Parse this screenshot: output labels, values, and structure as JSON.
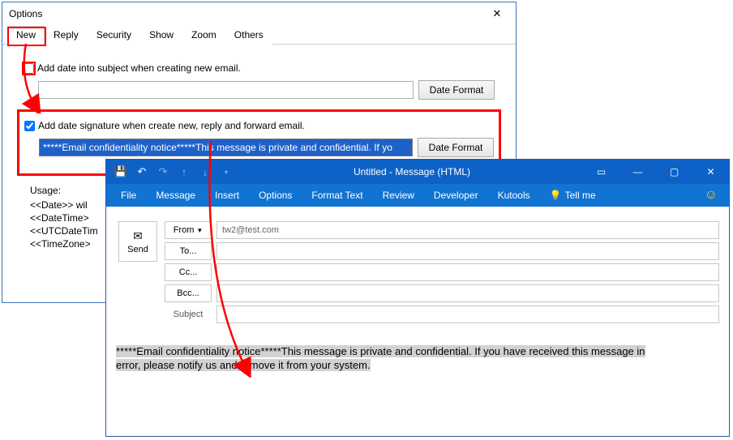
{
  "options": {
    "title": "Options",
    "tabs": [
      "New",
      "Reply",
      "Security",
      "Show",
      "Zoom",
      "Others"
    ],
    "active_tab": "New",
    "add_date_subject_label": "Add date into subject when creating new email.",
    "add_date_subject_checked": false,
    "add_date_subject_value": "",
    "date_format_btn": "Date Format",
    "add_sig_label": "Add date signature when create new, reply and forward email.",
    "add_sig_checked": true,
    "add_sig_value": "*****Email confidentiality notice*****This message is private and confidential. If yo",
    "usage_label": "Usage:",
    "usage_lines": [
      "<<Date>> wil",
      "<<DateTime>",
      "<<UTCDateTim",
      "<<TimeZone>"
    ]
  },
  "compose": {
    "window_title": "Untitled  -  Message (HTML)",
    "menu": [
      "File",
      "Message",
      "Insert",
      "Options",
      "Format Text",
      "Review",
      "Developer",
      "Kutools"
    ],
    "tell_me": "Tell me",
    "from_label": "From",
    "from_value": "tw2@test.com",
    "to_label": "To...",
    "cc_label": "Cc...",
    "bcc_label": "Bcc...",
    "subject_label": "Subject",
    "subject_value": "",
    "send_label": "Send",
    "body_line1": "*****Email confidentiality notice*****This message is private and confidential. If you have received this message in",
    "body_line2": "error, please notify us and remove it from your system."
  }
}
